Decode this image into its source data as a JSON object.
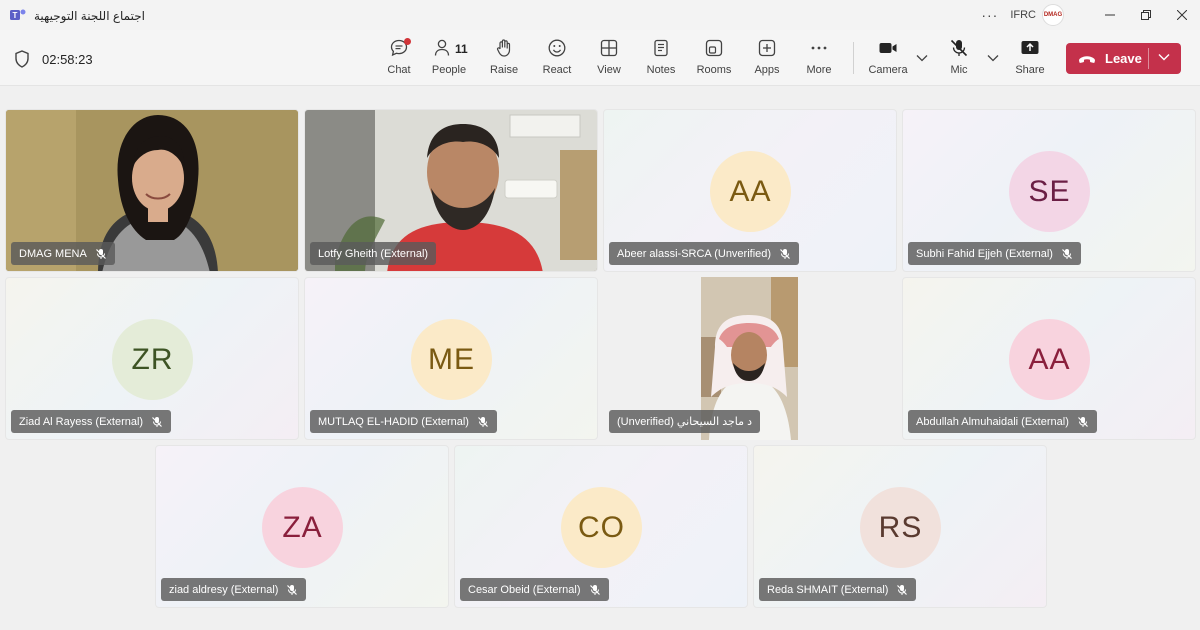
{
  "window": {
    "title": "اجتماع اللجنة التوجيهية",
    "org": "IFRC",
    "avatar_text": "DMAG",
    "more_dots": "···"
  },
  "toolbar": {
    "timer": "02:58:23",
    "tools": [
      {
        "label": "Chat",
        "icon": "chat-icon"
      },
      {
        "label": "People",
        "icon": "people-icon",
        "count": "11"
      },
      {
        "label": "Raise",
        "icon": "raise-hand-icon"
      },
      {
        "label": "React",
        "icon": "react-smiley-icon"
      },
      {
        "label": "View",
        "icon": "view-grid-icon"
      },
      {
        "label": "Notes",
        "icon": "notes-icon"
      },
      {
        "label": "Rooms",
        "icon": "rooms-icon"
      },
      {
        "label": "Apps",
        "icon": "apps-plus-icon"
      },
      {
        "label": "More",
        "icon": "more-dots-icon"
      },
      {
        "label": "Camera",
        "icon": "camera-icon"
      },
      {
        "label": "Mic",
        "icon": "mic-off-icon"
      },
      {
        "label": "Share",
        "icon": "share-icon"
      }
    ],
    "leave_label": "Leave"
  },
  "participants": [
    {
      "name": "DMAG MENA",
      "muted": true,
      "video": true
    },
    {
      "name": "Lotfy Gheith (External)",
      "muted": false,
      "video": true
    },
    {
      "name": "Abeer alassi-SRCA (Unverified)",
      "muted": true,
      "initials": "AA",
      "avatar_bg": "#fbeac8",
      "avatar_fg": "#7a5a12"
    },
    {
      "name": "Subhi Fahid Ejjeh (External)",
      "muted": true,
      "initials": "SE",
      "avatar_bg": "#f3d6e6",
      "avatar_fg": "#6b1f45"
    },
    {
      "name": "Ziad Al Rayess (External)",
      "muted": true,
      "initials": "ZR",
      "avatar_bg": "#e4ecd8",
      "avatar_fg": "#3d5424"
    },
    {
      "name": "MUTLAQ EL-HADID (External)",
      "muted": true,
      "initials": "ME",
      "avatar_bg": "#fbeac8",
      "avatar_fg": "#7a5a12"
    },
    {
      "name": "د ماجد السيحاني (Unverified)",
      "muted": false,
      "video": true
    },
    {
      "name": "Abdullah Almuhaidali (External)",
      "muted": true,
      "initials": "AA",
      "avatar_bg": "#f8d3de",
      "avatar_fg": "#8a1f3c"
    },
    {
      "name": "ziad aldresy (External)",
      "muted": true,
      "initials": "ZA",
      "avatar_bg": "#f8d3de",
      "avatar_fg": "#8a1f3c"
    },
    {
      "name": "Cesar Obeid (External)",
      "muted": true,
      "initials": "CO",
      "avatar_bg": "#fbeac8",
      "avatar_fg": "#7a5a12"
    },
    {
      "name": "Reda SHMAIT (External)",
      "muted": true,
      "initials": "RS",
      "avatar_bg": "#f1e1dc",
      "avatar_fg": "#5a3a30"
    }
  ],
  "colors": {
    "leave": "#c4314b",
    "notification_dot": "#d13438"
  }
}
